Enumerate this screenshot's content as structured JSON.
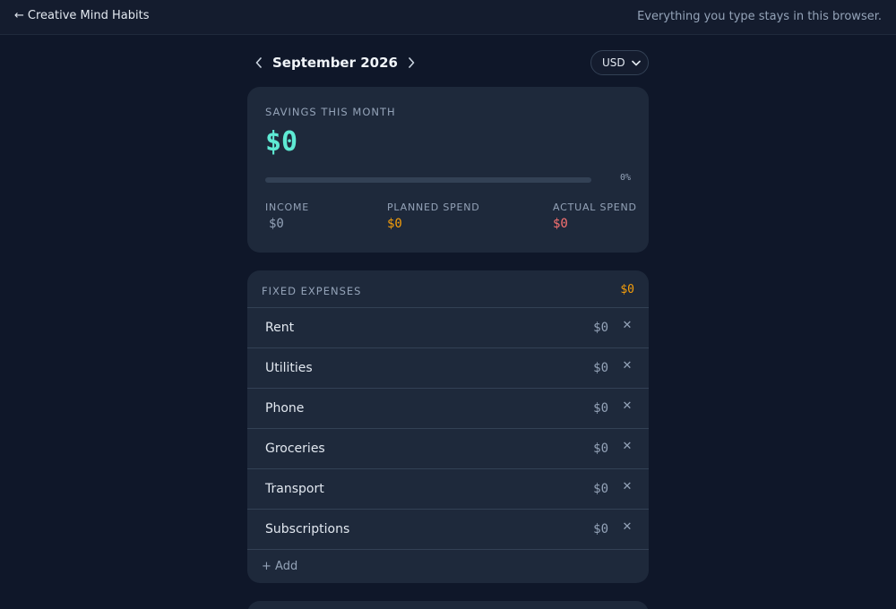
{
  "header": {
    "back_arrow": "←",
    "back_label": "Creative Mind Habits",
    "privacy_note": "Everything you type stays in this browser."
  },
  "month_nav": {
    "prev_icon": "‹",
    "month_label": "September 2026",
    "next_icon": "›"
  },
  "currency": {
    "selected": "USD"
  },
  "savings": {
    "title": "SAVINGS THIS MONTH",
    "amount": "$0",
    "progress_percent_label": "0%",
    "progress_fraction": 0,
    "income_label": "INCOME",
    "income_value": "$0",
    "planned_label": "PLANNED SPEND",
    "planned_value": "$0",
    "actual_label": "ACTUAL SPEND",
    "actual_value": "$0"
  },
  "fixed_expenses": {
    "title": "FIXED EXPENSES",
    "total": "$0",
    "remove_icon": "✕",
    "items": [
      {
        "name": "Rent",
        "amount": "$0"
      },
      {
        "name": "Utilities",
        "amount": "$0"
      },
      {
        "name": "Phone",
        "amount": "$0"
      },
      {
        "name": "Groceries",
        "amount": "$0"
      },
      {
        "name": "Transport",
        "amount": "$0"
      },
      {
        "name": "Subscriptions",
        "amount": "$0"
      }
    ],
    "add_label": "+ Add"
  },
  "colors": {
    "background": "#0f1729",
    "card": "#1e293b",
    "savings_accent": "#5eead4",
    "planned_accent": "#f59e0b",
    "actual_accent": "#f87171"
  }
}
